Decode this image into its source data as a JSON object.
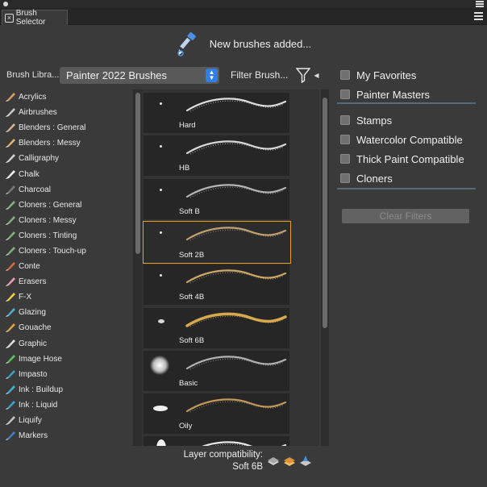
{
  "panel": {
    "tab_title": "Brush Selector"
  },
  "notice": {
    "text": "New brushes added..."
  },
  "library": {
    "label": "Brush Libra...",
    "selected": "Painter 2022 Brushes",
    "filter_label": "Filter Brush..."
  },
  "categories": [
    {
      "label": "Acrylics",
      "icon": "acrylics-icon",
      "color": "#d9a05b"
    },
    {
      "label": "Airbrushes",
      "icon": "airbrush-icon",
      "color": "#c8c8c8"
    },
    {
      "label": "Blenders : General",
      "icon": "blender-icon",
      "color": "#d9b38c"
    },
    {
      "label": "Blenders : Messy",
      "icon": "blender-messy-icon",
      "color": "#e0b070"
    },
    {
      "label": "Calligraphy",
      "icon": "calligraphy-icon",
      "color": "#d0d0d0"
    },
    {
      "label": "Chalk",
      "icon": "chalk-icon",
      "color": "#f0f0f0"
    },
    {
      "label": "Charcoal",
      "icon": "charcoal-icon",
      "color": "#777777"
    },
    {
      "label": "Cloners : General",
      "icon": "cloner-icon",
      "color": "#7fb27f"
    },
    {
      "label": "Cloners : Messy",
      "icon": "cloner-messy-icon",
      "color": "#7fb27f"
    },
    {
      "label": "Cloners : Tinting",
      "icon": "cloner-tinting-icon",
      "color": "#7fb27f"
    },
    {
      "label": "Cloners : Touch-up",
      "icon": "cloner-touchup-icon",
      "color": "#7fb27f"
    },
    {
      "label": "Conte",
      "icon": "conte-icon",
      "color": "#d06a3a"
    },
    {
      "label": "Erasers",
      "icon": "eraser-icon",
      "color": "#e8a0b0"
    },
    {
      "label": "F-X",
      "icon": "fx-icon",
      "color": "#f0d040"
    },
    {
      "label": "Glazing",
      "icon": "glazing-icon",
      "color": "#50b0d0"
    },
    {
      "label": "Gouache",
      "icon": "gouache-icon",
      "color": "#e0a040"
    },
    {
      "label": "Graphic",
      "icon": "graphic-icon",
      "color": "#e0e0e0"
    },
    {
      "label": "Image Hose",
      "icon": "image-hose-icon",
      "color": "#60c060"
    },
    {
      "label": "Impasto",
      "icon": "impasto-icon",
      "color": "#40a0c0"
    },
    {
      "label": "Ink : Buildup",
      "icon": "ink-buildup-icon",
      "color": "#40b0d0"
    },
    {
      "label": "Ink : Liquid",
      "icon": "ink-liquid-icon",
      "color": "#40a0d0"
    },
    {
      "label": "Liquify",
      "icon": "liquify-icon",
      "color": "#c0c0c0"
    },
    {
      "label": "Markers",
      "icon": "marker-icon",
      "color": "#4080c0"
    }
  ],
  "variants": [
    {
      "label": "Hard",
      "stroke": "#e8e8e8",
      "dab": "dot"
    },
    {
      "label": "HB",
      "stroke": "#e0e0e0",
      "dab": "dot"
    },
    {
      "label": "Soft B",
      "stroke": "#bdbdbd",
      "dab": "dot"
    },
    {
      "label": "Soft 2B",
      "stroke": "#c9a878",
      "dab": "dot"
    },
    {
      "label": "Soft 4B",
      "stroke": "#d6b06a",
      "dab": "dot"
    },
    {
      "label": "Soft 6B",
      "stroke": "#e0b050",
      "dab": "smudge"
    },
    {
      "label": "Basic",
      "stroke": "#b8b8b8",
      "dab": "soft-round"
    },
    {
      "label": "Oily",
      "stroke": "#c8a060",
      "dab": "flat"
    },
    {
      "label": "",
      "stroke": "#f0f0f0",
      "dab": "tall"
    }
  ],
  "selected_variant_index": 3,
  "filters": {
    "items": [
      {
        "label": "My Favorites"
      },
      {
        "label": "Painter Masters"
      },
      {
        "label": "Stamps"
      },
      {
        "label": "Watercolor Compatible"
      },
      {
        "label": "Thick Paint Compatible"
      },
      {
        "label": "Cloners"
      }
    ],
    "clear_label": "Clear Filters"
  },
  "layer_compat": {
    "title": "Layer compatibility:",
    "value": "Soft 6B"
  },
  "colors": {
    "accent_selection": "#e8a01e",
    "panel_bg": "#3a3a3a",
    "select_chevron": "#2f7fe6"
  }
}
